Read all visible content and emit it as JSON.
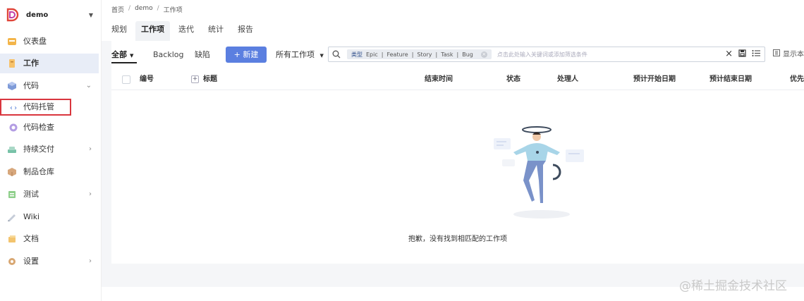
{
  "project": {
    "name": "demo"
  },
  "sidebar": {
    "items": [
      {
        "label": "仪表盘",
        "icon": "dashboard-icon",
        "has_arrow": false
      },
      {
        "label": "工作",
        "icon": "work-icon",
        "has_arrow": false,
        "active": true
      },
      {
        "label": "代码",
        "icon": "code-icon",
        "has_arrow": true,
        "arrow": "⌄"
      },
      {
        "label": "代码托管",
        "icon": "code-hosting-icon",
        "has_arrow": false
      },
      {
        "label": "代码检查",
        "icon": "code-check-icon",
        "has_arrow": false
      },
      {
        "label": "持续交付",
        "icon": "delivery-icon",
        "has_arrow": true,
        "arrow": "›"
      },
      {
        "label": "制品仓库",
        "icon": "artifact-icon",
        "has_arrow": false
      },
      {
        "label": "测试",
        "icon": "test-icon",
        "has_arrow": true,
        "arrow": "›"
      },
      {
        "label": "Wiki",
        "icon": "wiki-icon",
        "has_arrow": false
      },
      {
        "label": "文档",
        "icon": "docs-icon",
        "has_arrow": false
      },
      {
        "label": "设置",
        "icon": "settings-icon",
        "has_arrow": true,
        "arrow": "›"
      }
    ]
  },
  "breadcrumb": [
    "首页",
    "demo",
    "工作项"
  ],
  "tabs": [
    {
      "label": "规划",
      "active": false
    },
    {
      "label": "工作项",
      "active": true
    },
    {
      "label": "迭代",
      "active": false
    },
    {
      "label": "统计",
      "active": false
    },
    {
      "label": "报告",
      "active": false
    }
  ],
  "toolbar": {
    "all_label": "全部",
    "backlog_label": "Backlog",
    "bug_label": "缺陷",
    "new_label": "+ 新建",
    "all_items_label": "所有工作项",
    "filter_chip": {
      "key": "类型",
      "values": [
        "Epic",
        "Feature",
        "Story",
        "Task",
        "Bug"
      ]
    },
    "search_placeholder": "点击此处输入关键词或添加筛选条件",
    "show_label": "显示本"
  },
  "table": {
    "columns": [
      "编号",
      "标题",
      "结束时间",
      "状态",
      "处理人",
      "预计开始日期",
      "预计结束日期",
      "优先"
    ]
  },
  "empty_message": "抱歉，没有找到相匹配的工作项",
  "watermark": "@稀土掘金技术社区",
  "colors": {
    "primary": "#5b7fe0",
    "highlight_border": "#d9363e",
    "active_nav_bg": "#e8edf7"
  }
}
